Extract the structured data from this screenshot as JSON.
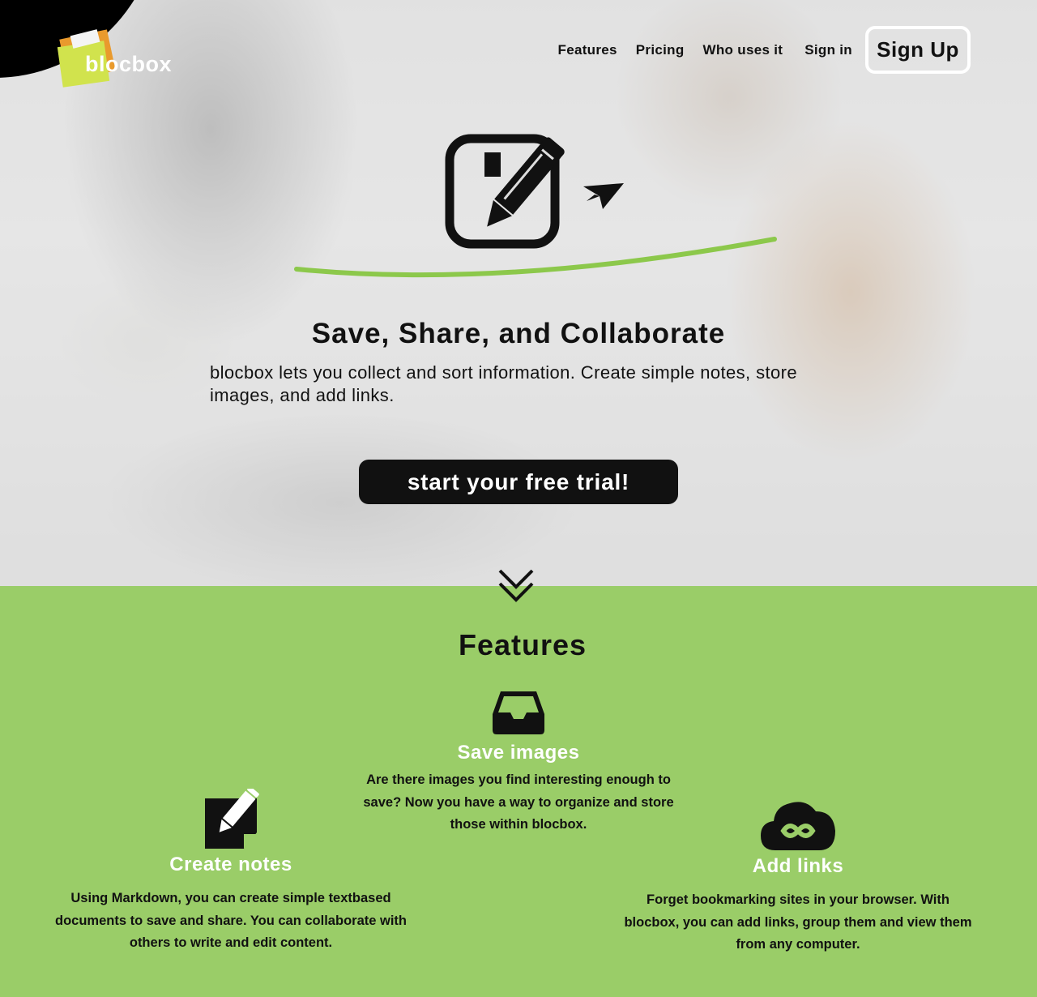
{
  "brand": {
    "name": "blocbox"
  },
  "nav": {
    "features": "Features",
    "pricing": "Pricing",
    "who_uses_it": "Who uses it",
    "sign_in": "Sign in",
    "sign_up": "Sign Up"
  },
  "hero": {
    "title": "Save, Share, and Collaborate",
    "description": "blocbox lets you collect and sort information. Create simple notes, store images, and add links.",
    "cta": "start your free trial!",
    "icon": "edit-send-icon",
    "scroll_icon": "double-chevron-down-icon"
  },
  "features": {
    "heading": "Features",
    "items": [
      {
        "icon": "inbox-tray-icon",
        "title": "Save images",
        "description": "Are there images you find interesting enough to save? Now you have a way to organize and store those within blocbox."
      },
      {
        "icon": "note-pencil-icon",
        "title": "Create notes",
        "description": "Using Markdown, you can create simple textbased documents to save and share. You can collaborate with others to write and edit content."
      },
      {
        "icon": "cloud-link-icon",
        "title": "Add links",
        "description": "Forget bookmarking sites in your browser. With blocbox, you can add links, group them and view them from any computer."
      }
    ]
  },
  "colors": {
    "accent_green": "#9acd68",
    "curve_green": "#8cc84b",
    "logo_orange": "#e99a2d",
    "logo_lime": "#d1e34d",
    "dark": "#111111",
    "white": "#ffffff"
  }
}
